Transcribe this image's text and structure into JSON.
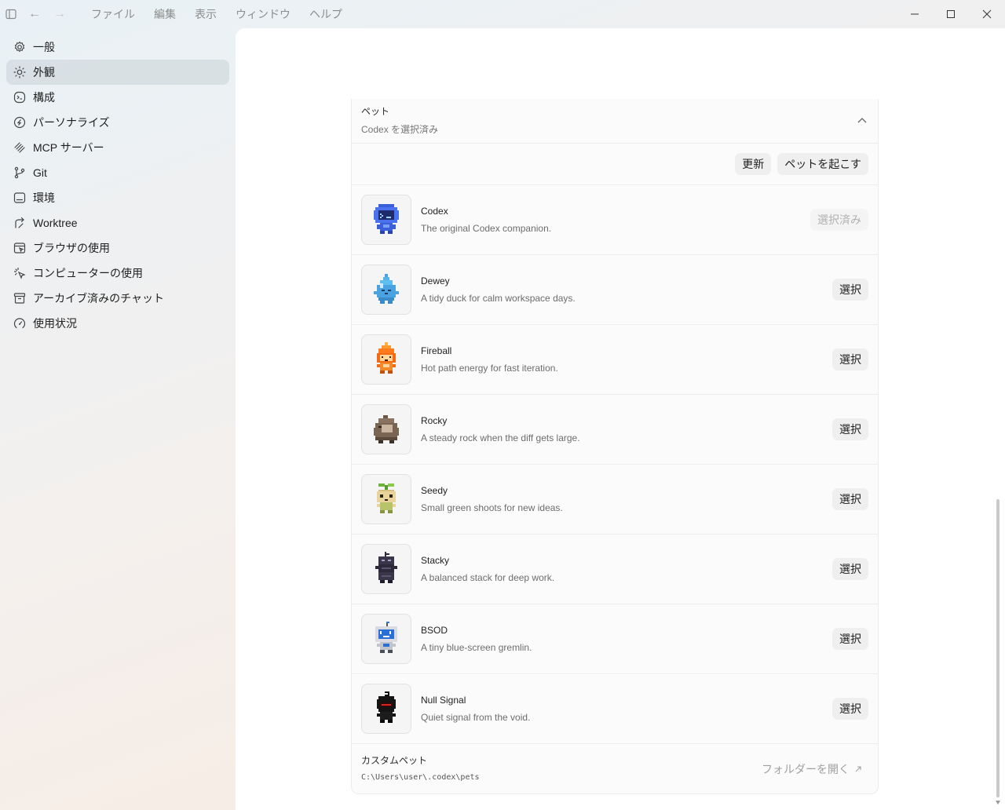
{
  "menu": [
    "ファイル",
    "編集",
    "表示",
    "ウィンドウ",
    "ヘルプ"
  ],
  "sidebar": {
    "items": [
      {
        "label": "一般",
        "icon": "gear-icon",
        "active": false
      },
      {
        "label": "外観",
        "icon": "sun-icon",
        "active": true
      },
      {
        "label": "構成",
        "icon": "config-icon",
        "active": false
      },
      {
        "label": "パーソナライズ",
        "icon": "personalize-icon",
        "active": false
      },
      {
        "label": "MCP サーバー",
        "icon": "mcp-icon",
        "active": false
      },
      {
        "label": "Git",
        "icon": "git-branch-icon",
        "active": false
      },
      {
        "label": "環境",
        "icon": "environment-icon",
        "active": false
      },
      {
        "label": "Worktree",
        "icon": "worktree-icon",
        "active": false
      },
      {
        "label": "ブラウザの使用",
        "icon": "browser-icon",
        "active": false
      },
      {
        "label": "コンピューターの使用",
        "icon": "cursor-click-icon",
        "active": false
      },
      {
        "label": "アーカイブ済みのチャット",
        "icon": "archive-icon",
        "active": false
      },
      {
        "label": "使用状況",
        "icon": "gauge-icon",
        "active": false
      }
    ]
  },
  "pets": {
    "title": "ペット",
    "subtitle": "Codex を選択済み",
    "refresh_label": "更新",
    "wake_label": "ペットを起こす",
    "items": [
      {
        "name": "Codex",
        "desc": "The original Codex companion.",
        "action": "選択済み",
        "selected": true
      },
      {
        "name": "Dewey",
        "desc": "A tidy duck for calm workspace days.",
        "action": "選択",
        "selected": false
      },
      {
        "name": "Fireball",
        "desc": "Hot path energy for fast iteration.",
        "action": "選択",
        "selected": false
      },
      {
        "name": "Rocky",
        "desc": "A steady rock when the diff gets large.",
        "action": "選択",
        "selected": false
      },
      {
        "name": "Seedy",
        "desc": "Small green shoots for new ideas.",
        "action": "選択",
        "selected": false
      },
      {
        "name": "Stacky",
        "desc": "A balanced stack for deep work.",
        "action": "選択",
        "selected": false
      },
      {
        "name": "BSOD",
        "desc": "A tiny blue-screen gremlin.",
        "action": "選択",
        "selected": false
      },
      {
        "name": "Null Signal",
        "desc": "Quiet signal from the void.",
        "action": "選択",
        "selected": false
      }
    ],
    "custom_title": "カスタムペット",
    "custom_path": "C:\\Users\\user\\.codex\\pets",
    "open_folder_label": "フォルダーを開く"
  }
}
